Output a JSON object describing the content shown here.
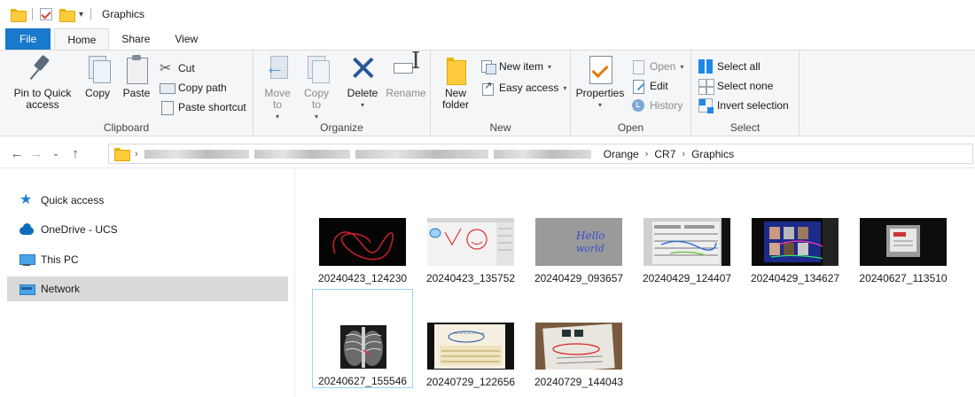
{
  "window": {
    "title": "Graphics"
  },
  "tabs": [
    {
      "label": "File"
    },
    {
      "label": "Home"
    },
    {
      "label": "Share"
    },
    {
      "label": "View"
    }
  ],
  "ribbon": {
    "clipboard": {
      "label": "Clipboard",
      "pin": "Pin to Quick access",
      "copy": "Copy",
      "paste": "Paste",
      "cut": "Cut",
      "copy_path": "Copy path",
      "paste_shortcut": "Paste shortcut"
    },
    "organize": {
      "label": "Organize",
      "move_to": "Move to",
      "copy_to": "Copy to",
      "delete": "Delete",
      "rename": "Rename"
    },
    "new": {
      "label": "New",
      "new_folder": "New folder",
      "new_item": "New item",
      "easy_access": "Easy access"
    },
    "open": {
      "label": "Open",
      "properties": "Properties",
      "open": "Open",
      "edit": "Edit",
      "history": "History"
    },
    "select": {
      "label": "Select",
      "select_all": "Select all",
      "select_none": "Select none",
      "invert_selection": "Invert selection"
    }
  },
  "address": {
    "crumbs": [
      "Orange",
      "CR7",
      "Graphics"
    ]
  },
  "navpane": {
    "items": [
      {
        "label": "Quick access",
        "icon": "star-icon"
      },
      {
        "label": "OneDrive - UCS",
        "icon": "cloud-icon"
      },
      {
        "label": "This PC",
        "icon": "computer-icon"
      },
      {
        "label": "Network",
        "icon": "network-icon"
      }
    ]
  },
  "files": [
    {
      "name": "20240423_124230"
    },
    {
      "name": "20240423_135752"
    },
    {
      "name": "20240429_093657"
    },
    {
      "name": "20240429_124407"
    },
    {
      "name": "20240429_134627"
    },
    {
      "name": "20240627_113510"
    },
    {
      "name": "20240627_155546"
    },
    {
      "name": "20240729_122656"
    },
    {
      "name": "20240729_144043"
    }
  ],
  "colors": {
    "file_tab": "#1979ca",
    "ribbon_bg": "#f5f6f7",
    "nav_selected": "#d9d9d9",
    "focus_border": "#99d1ff"
  }
}
